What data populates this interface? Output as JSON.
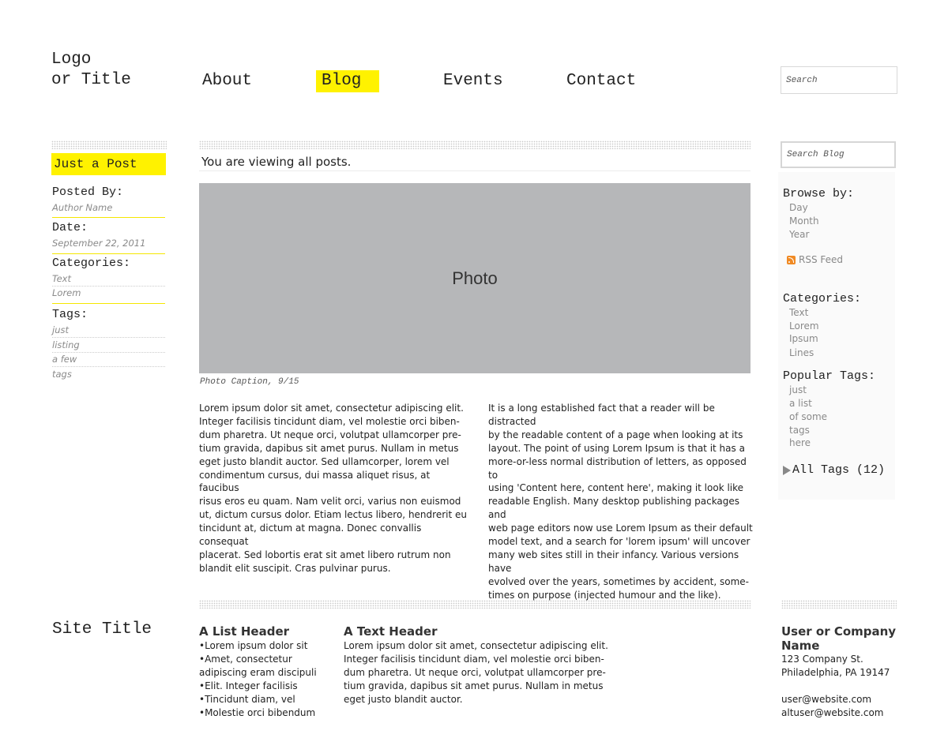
{
  "header": {
    "logo": "Logo\nor Title",
    "nav": [
      {
        "label": "About"
      },
      {
        "label": "Blog"
      },
      {
        "label": "Events"
      },
      {
        "label": "Contact"
      }
    ],
    "active_nav": "Blog",
    "search_placeholder": "Search",
    "accent": "#fff200"
  },
  "sidebar_left": {
    "post_title": "Just a Post",
    "posted_by_label": "Posted By:",
    "author": "Author Name",
    "date_label": "Date:",
    "date": "September 22, 2011",
    "categories_label": "Categories:",
    "categories": [
      "Text",
      "Lorem"
    ],
    "tags_label": "Tags:",
    "tags": [
      "just",
      "listing",
      "a few",
      "tags"
    ]
  },
  "main": {
    "viewing_text": "You are viewing all posts.",
    "photo_label": "Photo",
    "photo_caption": "Photo Caption, 9/15",
    "col1": "Lorem ipsum dolor sit amet, consectetur adipiscing elit.\nInteger facilisis tincidunt diam, vel molestie orci biben-\ndum pharetra. Ut neque orci, volutpat ullamcorper pre-\ntium gravida, dapibus sit amet purus. Nullam in metus\neget justo blandit auctor. Sed ullamcorper, lorem vel\ncondimentum cursus, dui massa aliquet risus, at faucibus\nrisus eros eu quam. Nam velit orci, varius non euismod\nut, dictum cursus dolor. Etiam lectus libero, hendrerit eu\ntincidunt at, dictum at magna. Donec convallis consequat\nplacerat. Sed lobortis erat sit amet libero rutrum non\nblandit elit suscipit. Cras pulvinar purus.",
    "col2": "It is a long established fact that a reader will be distracted\nby the readable content of a page when looking at its\nlayout. The point of using Lorem Ipsum is that it has a\nmore-or-less normal distribution of letters, as opposed to\nusing 'Content here, content here', making it look like\nreadable English. Many desktop publishing packages and\nweb page editors now use Lorem Ipsum as their default\nmodel text, and a search for 'lorem ipsum' will uncover\nmany web sites still in their infancy. Various versions have\nevolved over the years, sometimes by accident, some-\ntimes on purpose (injected humour and the like)."
  },
  "sidebar_right": {
    "search_placeholder": "Search Blog",
    "browse_label": "Browse by:",
    "browse": [
      "Day",
      "Month",
      "Year"
    ],
    "rss": "RSS Feed",
    "categories_label": "Categories:",
    "categories": [
      "Text",
      "Lorem",
      "Ipsum",
      "Lines"
    ],
    "tags_label": "Popular Tags:",
    "tags": [
      "just",
      "a list",
      "of some",
      "tags",
      "here"
    ],
    "all_tags": "All Tags (12)"
  },
  "footer": {
    "site_title": "Site Title",
    "list_header": "A List Header",
    "list_items": [
      "•Lorem ipsum dolor sit",
      "•Amet, consectetur",
      "adipiscing eram discipuli",
      "•Elit. Integer facilisis",
      "•Tincidunt diam, vel",
      "•Molestie orci bibendum"
    ],
    "text_header": "A Text Header",
    "text": "Lorem ipsum dolor sit amet, consectetur adipiscing elit.\nInteger facilisis tincidunt diam, vel molestie orci biben-\ndum pharetra. Ut neque orci, volutpat ullamcorper pre-\ntium gravida, dapibus sit amet purus. Nullam in metus\neget justo blandit auctor.",
    "company_name": "User or Company Name",
    "address1": "123 Company St.",
    "address2": "Philadelphia, PA 19147",
    "email1": "user@website.com",
    "email2": "altuser@website.com"
  }
}
